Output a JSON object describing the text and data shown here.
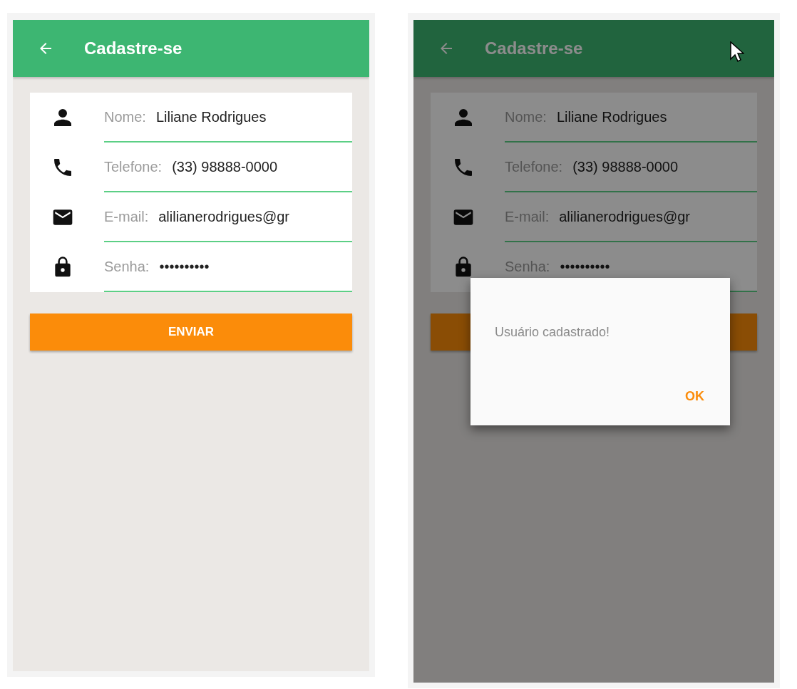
{
  "screens": [
    {
      "title": "Cadastre-se",
      "fields": [
        {
          "kind": "person",
          "label": "Nome:",
          "value": "Liliane Rodrigues"
        },
        {
          "kind": "phone",
          "label": "Telefone:",
          "value": "(33) 98888-0000"
        },
        {
          "kind": "email",
          "label": "E-mail:",
          "value": "alilianerodrigues@gr"
        },
        {
          "kind": "lock",
          "label": "Senha:",
          "value": "••••••••••"
        }
      ],
      "submit": "ENVIAR"
    },
    {
      "title": "Cadastre-se",
      "fields": [
        {
          "kind": "person",
          "label": "Nome:",
          "value": "Liliane Rodrigues"
        },
        {
          "kind": "phone",
          "label": "Telefone:",
          "value": "(33) 98888-0000"
        },
        {
          "kind": "email",
          "label": "E-mail:",
          "value": "alilianerodrigues@gr"
        },
        {
          "kind": "lock",
          "label": "Senha:",
          "value": "••••••••••"
        }
      ],
      "dialog": {
        "message": "Usuário cadastrado!",
        "button": "OK"
      }
    }
  ]
}
